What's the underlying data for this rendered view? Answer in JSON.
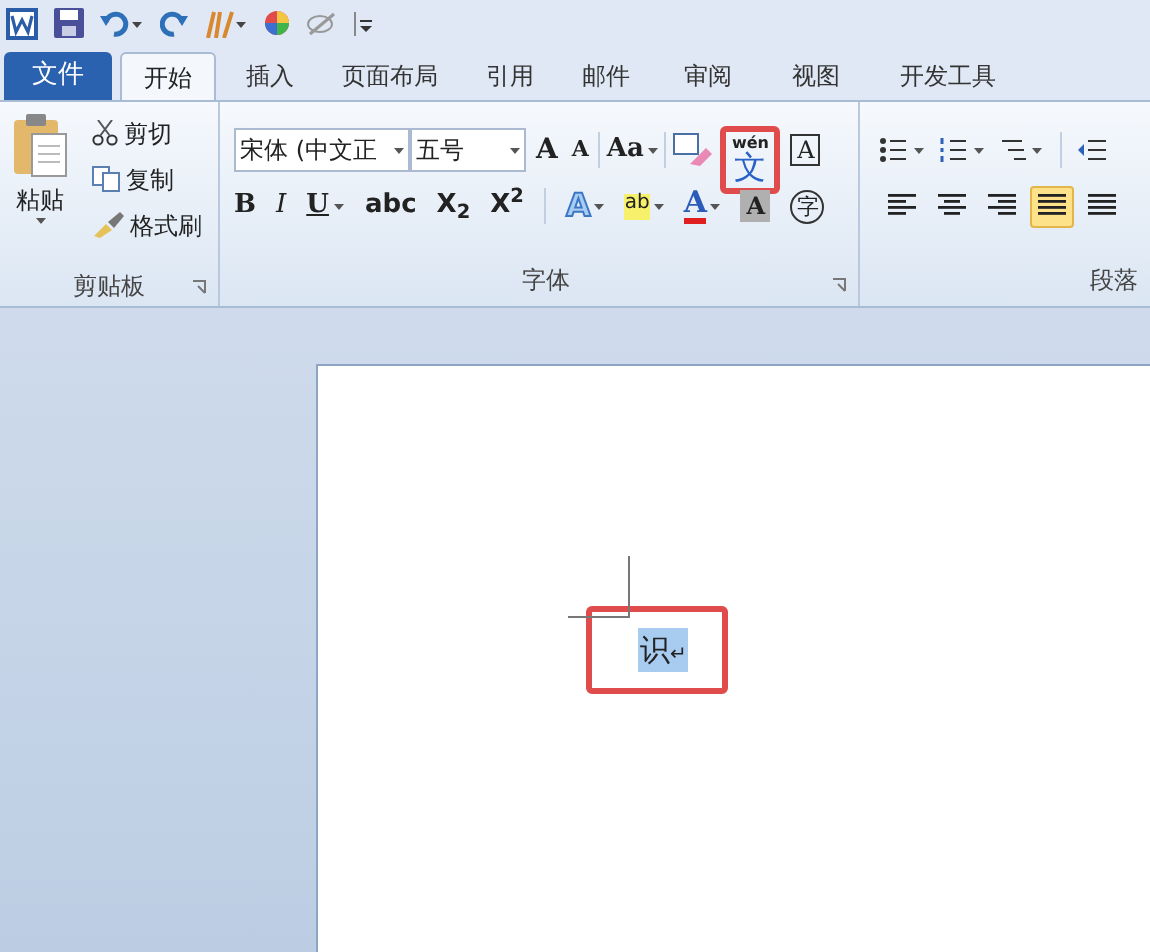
{
  "tabs": [
    {
      "label": "文件",
      "kind": "file",
      "selected": false
    },
    {
      "label": "开始",
      "kind": "tab",
      "selected": true
    },
    {
      "label": "插入",
      "kind": "tab",
      "selected": false
    },
    {
      "label": "页面布局",
      "kind": "tab",
      "selected": false
    },
    {
      "label": "引用",
      "kind": "tab",
      "selected": false
    },
    {
      "label": "邮件",
      "kind": "tab",
      "selected": false
    },
    {
      "label": "审阅",
      "kind": "tab",
      "selected": false
    },
    {
      "label": "视图",
      "kind": "tab",
      "selected": false
    },
    {
      "label": "开发工具",
      "kind": "tab",
      "selected": false
    }
  ],
  "clipboard": {
    "paste": "粘贴",
    "items": [
      "剪切",
      "复制",
      "格式刷"
    ],
    "label": "剪贴板"
  },
  "font": {
    "name": "宋体 (中文正",
    "size": "五号",
    "grow": "A",
    "shrink": "A",
    "case": "Aa",
    "ruby": "wén",
    "ruby_char": "文",
    "border_char": "A",
    "format": [
      "B",
      "I",
      "U",
      "abc",
      "X$_{2}$",
      "X$^{2}$"
    ],
    "effect": "A",
    "highlight": "ab",
    "color_letter": "A",
    "shading": "A",
    "enclosed": "字",
    "label": "字体"
  },
  "paragraph": {
    "label": "段落",
    "align": [
      {
        "selected": false
      },
      {
        "selected": false
      },
      {
        "selected": false
      },
      {
        "selected": true
      },
      {
        "selected": false
      }
    ]
  },
  "document": {
    "text": "识",
    "mark": "↵"
  }
}
